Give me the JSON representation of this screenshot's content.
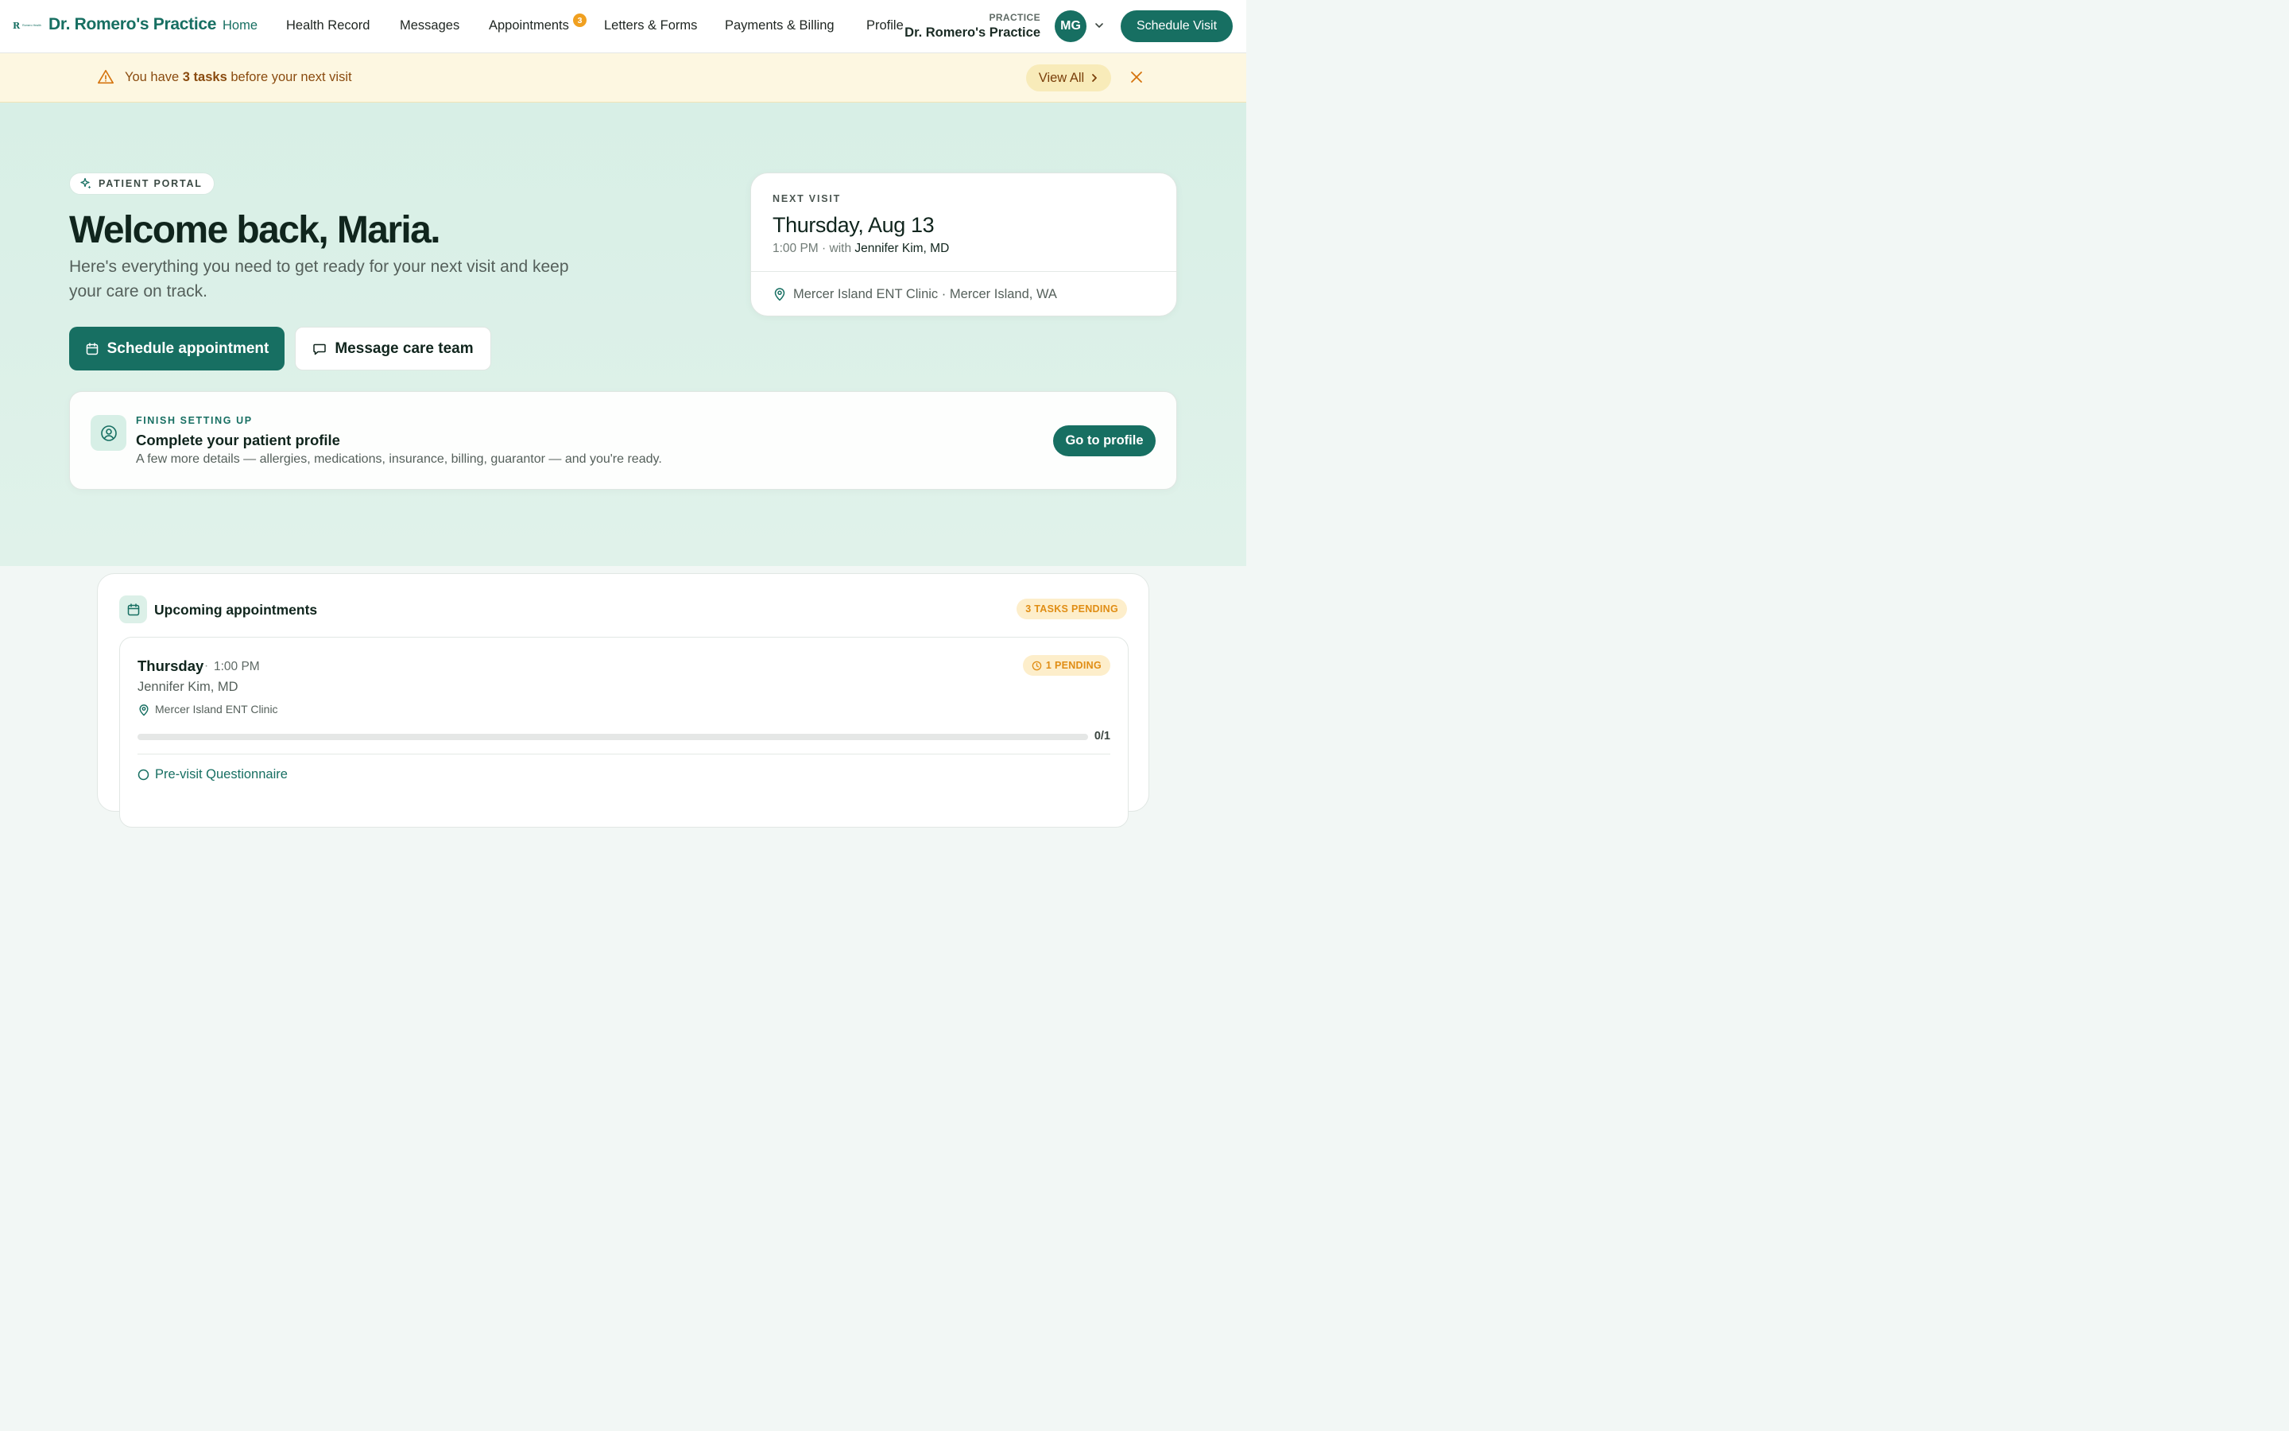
{
  "brand": {
    "name": "Dr. Romero's Practice",
    "logo_letter": "R",
    "logo_tiny": "Romero Health"
  },
  "nav": {
    "items": [
      {
        "label": "Home",
        "active": true
      },
      {
        "label": "Health Record"
      },
      {
        "label": "Messages"
      },
      {
        "label": "Appointments",
        "badge": "3"
      },
      {
        "label": "Letters & Forms"
      },
      {
        "label": "Payments & Billing"
      },
      {
        "label": "Profile"
      }
    ],
    "practice_eyebrow": "PRACTICE",
    "practice_name": "Dr. Romero's Practice",
    "avatar_initials": "MG",
    "schedule_visit_label": "Schedule Visit"
  },
  "banner": {
    "text_before": "You have ",
    "text_bold": "3 tasks",
    "text_after": " before your next visit",
    "view_all_label": "View All",
    "icons": [
      "warning-icon",
      "chevron-right-icon",
      "close-icon"
    ]
  },
  "hero": {
    "chip_label": "PATIENT PORTAL",
    "welcome": "Welcome back, Maria.",
    "subtitle": "Here's everything you need to get ready for your next visit and keep your care on track.",
    "primary_button": "Schedule appointment",
    "secondary_button": "Message care team"
  },
  "next_visit": {
    "eyebrow": "NEXT VISIT",
    "date": "Thursday, Aug 13",
    "time": "1:00 PM",
    "with_label": "with",
    "doctor": "Jennifer Kim, MD",
    "location": "Mercer Island ENT Clinic · Mercer Island, WA"
  },
  "setup": {
    "eyebrow": "FINISH SETTING UP",
    "title": "Complete your patient profile",
    "description": "A few more details — allergies, medications, insurance, billing, guarantor — and you're ready.",
    "button": "Go to profile"
  },
  "appointments": {
    "title": "Upcoming appointments",
    "tasks_pending": "3 TASKS PENDING",
    "items": [
      {
        "day": "Thursday",
        "time": "1:00 PM",
        "doctor": "Jennifer Kim, MD",
        "location": "Mercer Island ENT Clinic",
        "pending": "1 PENDING",
        "progress_fraction": 0,
        "progress_label": "0/1",
        "task": "Pre-visit Questionnaire"
      }
    ]
  },
  "colors": {
    "brand": "#176f62",
    "accent_orange": "#f0a020",
    "banner_bg": "#fdf7e1",
    "hero_bg": "#d8efe6"
  }
}
